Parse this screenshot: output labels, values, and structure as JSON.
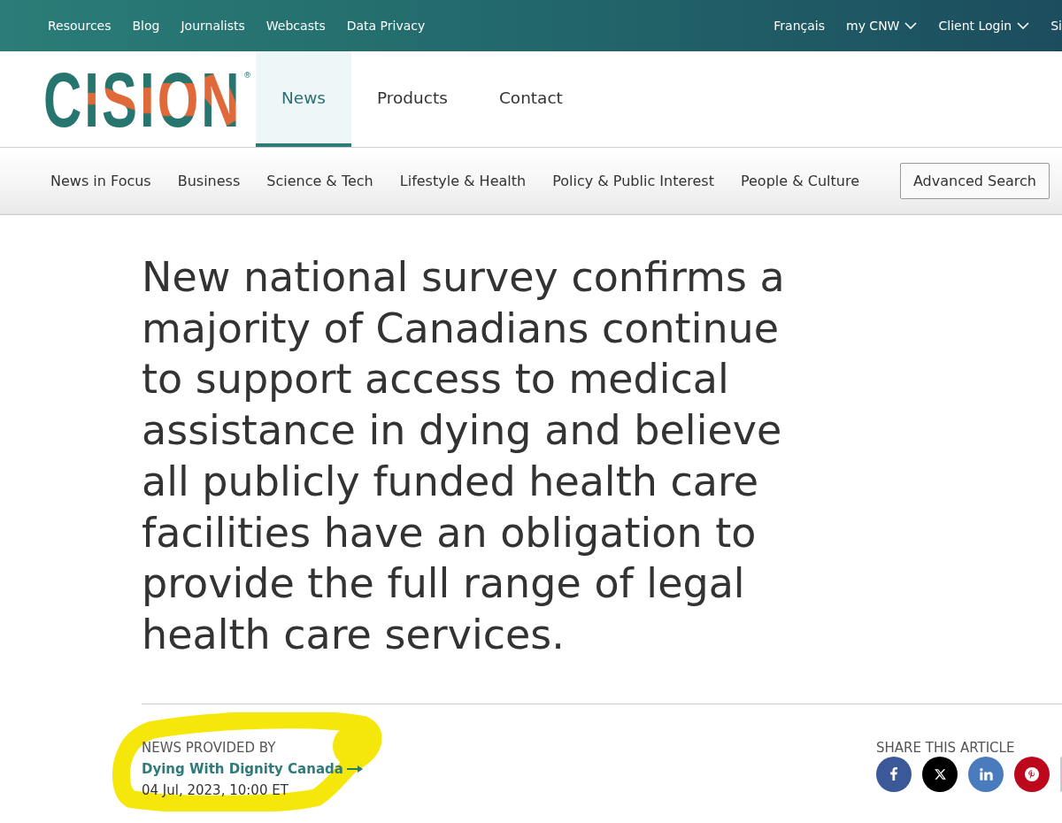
{
  "top_bar": {
    "left_links": [
      "Resources",
      "Blog",
      "Journalists",
      "Webcasts",
      "Data Privacy"
    ],
    "right_links": [
      {
        "label": "Français",
        "dropdown": false
      },
      {
        "label": "my CNW",
        "dropdown": true
      },
      {
        "label": "Client Login",
        "dropdown": true
      },
      {
        "label": "Si",
        "dropdown": false
      }
    ]
  },
  "header": {
    "logo": {
      "text": "CISION",
      "mark": "®"
    },
    "nav": [
      {
        "label": "News",
        "selected": true
      },
      {
        "label": "Products",
        "selected": false
      },
      {
        "label": "Contact",
        "selected": false
      }
    ]
  },
  "categories": {
    "items": [
      "News in Focus",
      "Business",
      "Science & Tech",
      "Lifestyle & Health",
      "Policy & Public Interest",
      "People & Culture"
    ],
    "button": "Advanced Search"
  },
  "article": {
    "headline": "New national survey confirms a majority of Canadians continue to support access to medical assistance in dying and believe all publicly funded health care facilities have an obligation to provide the full range of legal health care services.",
    "source": {
      "label": "NEWS PROVIDED BY",
      "name": "Dying With Dignity Canada",
      "date": "04 Jul, 2023, 10:00 ET",
      "highlighted": true
    },
    "share": {
      "label": "SHARE THIS ARTICLE",
      "buttons": [
        {
          "kind": "facebook"
        },
        {
          "kind": "x"
        },
        {
          "kind": "linkedin"
        },
        {
          "kind": "pinterest"
        },
        {
          "kind": "partial"
        }
      ]
    }
  }
}
